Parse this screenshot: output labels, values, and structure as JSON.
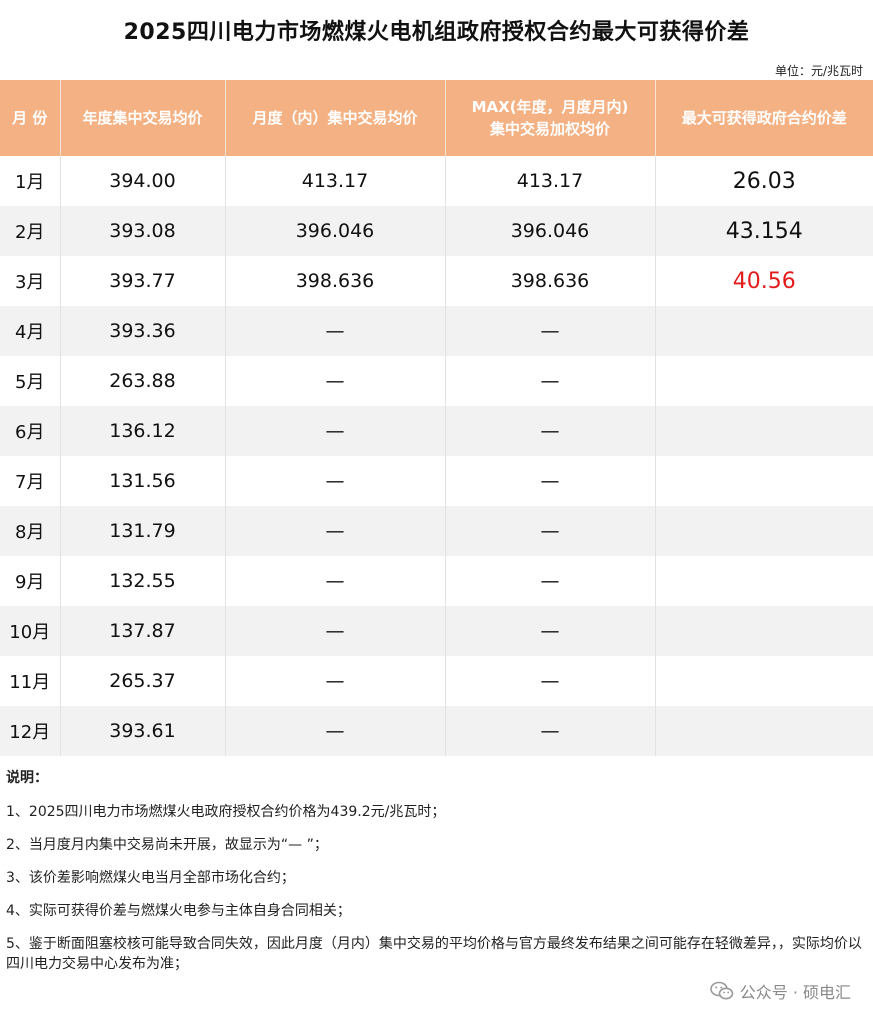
{
  "title": "2025四川电力市场燃煤火电机组政府授权合约最大可获得价差",
  "unit": "单位：元/兆瓦时",
  "table": {
    "headers": [
      "月 份",
      "年度集中交易均价",
      "月度（内）集中交易均价",
      [
        "MAX(年度，月度月内)",
        "集中交易加权均价"
      ],
      "最大可获得政府合约价差"
    ],
    "rows": [
      {
        "month": "1月",
        "annual": "394.00",
        "monthly": "413.17",
        "max": "413.17",
        "diff": "26.03",
        "highlight": false
      },
      {
        "month": "2月",
        "annual": "393.08",
        "monthly": "396.046",
        "max": "396.046",
        "diff": "43.154",
        "highlight": false
      },
      {
        "month": "3月",
        "annual": "393.77",
        "monthly": "398.636",
        "max": "398.636",
        "diff": "40.56",
        "highlight": true
      },
      {
        "month": "4月",
        "annual": "393.36",
        "monthly": "—",
        "max": "—",
        "diff": ""
      },
      {
        "month": "5月",
        "annual": "263.88",
        "monthly": "—",
        "max": "—",
        "diff": ""
      },
      {
        "month": "6月",
        "annual": "136.12",
        "monthly": "—",
        "max": "—",
        "diff": ""
      },
      {
        "month": "7月",
        "annual": "131.56",
        "monthly": "—",
        "max": "—",
        "diff": ""
      },
      {
        "month": "8月",
        "annual": "131.79",
        "monthly": "—",
        "max": "—",
        "diff": ""
      },
      {
        "month": "9月",
        "annual": "132.55",
        "monthly": "—",
        "max": "—",
        "diff": ""
      },
      {
        "month": "10月",
        "annual": "137.87",
        "monthly": "—",
        "max": "—",
        "diff": ""
      },
      {
        "month": "11月",
        "annual": "265.37",
        "monthly": "—",
        "max": "—",
        "diff": ""
      },
      {
        "month": "12月",
        "annual": "393.61",
        "monthly": "—",
        "max": "—",
        "diff": ""
      }
    ]
  },
  "notes": {
    "heading": "说明：",
    "items": [
      "1、2025四川电力市场燃煤火电政府授权合约价格为439.2元/兆瓦时；",
      "2、当月度月内集中交易尚未开展，故显示为“— ”；",
      "3、该价差影响燃煤火电当月全部市场化合约；",
      "4、实际可获得价差与燃煤火电参与主体自身合同相关；",
      "5、鉴于断面阻塞校核可能导致合同失效，因此月度（月内）集中交易的平均价格与官方最终发布结果之间可能存在轻微差异，，实际均价以四川电力交易中心发布为准；"
    ]
  },
  "watermark": {
    "text": "公众号 · 硕电汇",
    "icon": "wechat-icon"
  },
  "colors": {
    "header_bg": "#f4b183",
    "stripe": "#f2f2f2",
    "highlight": "#e21b1b"
  }
}
